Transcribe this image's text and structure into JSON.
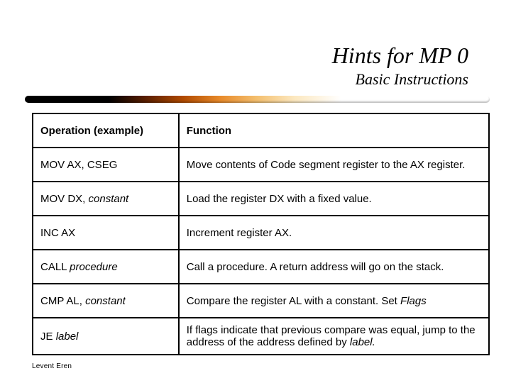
{
  "title": "Hints for MP 0",
  "subtitle": "Basic Instructions",
  "headers": {
    "operation": "Operation (example)",
    "function": "Function"
  },
  "rows": [
    {
      "op_pre": "MOV AX, CSEG",
      "op_it": "",
      "fn_pre": "Move contents of Code segment register to the AX register.",
      "fn_it": ""
    },
    {
      "op_pre": "MOV DX, ",
      "op_it": "constant",
      "fn_pre": "Load the register DX with a fixed value.",
      "fn_it": ""
    },
    {
      "op_pre": "INC AX",
      "op_it": "",
      "fn_pre": "Increment register AX.",
      "fn_it": ""
    },
    {
      "op_pre": "CALL ",
      "op_it": "procedure",
      "fn_pre": "Call a procedure.  A return address will go on the stack.",
      "fn_it": ""
    },
    {
      "op_pre": "CMP AL, ",
      "op_it": "constant",
      "fn_pre": "Compare the register AL with a constant.  Set ",
      "fn_it": "Flags"
    },
    {
      "op_pre": "JE ",
      "op_it": "label",
      "fn_pre": "If flags indicate that previous compare was equal, jump to the address of the address defined by ",
      "fn_it": "label."
    }
  ],
  "footer": "Levent Eren"
}
